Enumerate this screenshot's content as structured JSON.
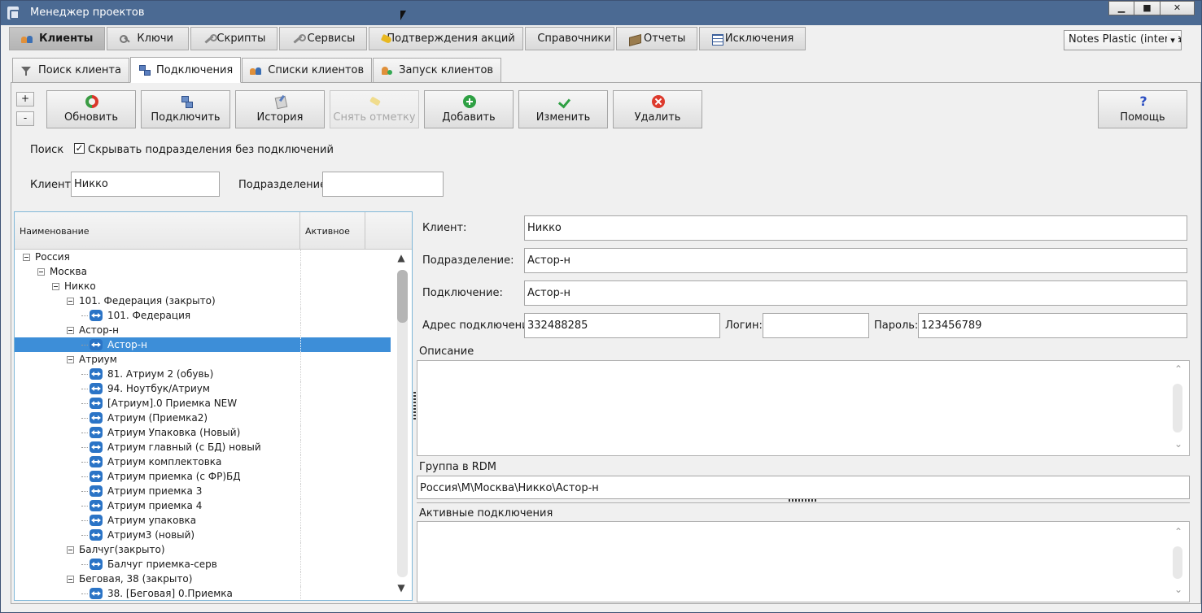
{
  "window": {
    "title": "Менеджер проектов",
    "buttons": {
      "minimize": "▁",
      "maximize": "■",
      "close": "✕"
    }
  },
  "main_tabs": [
    {
      "label": "Клиенты",
      "icon": "people-icon",
      "active": true
    },
    {
      "label": "Ключи",
      "icon": "key-icon"
    },
    {
      "label": "Скрипты",
      "icon": "wrench-icon"
    },
    {
      "label": "Сервисы",
      "icon": "wrench-icon"
    },
    {
      "label": "Подтверждения акций",
      "icon": "hand-icon"
    },
    {
      "label": "Справочники",
      "icon": ""
    },
    {
      "label": "Отчеты",
      "icon": "book-icon"
    },
    {
      "label": "Исключения",
      "icon": "table-icon"
    }
  ],
  "org_select": {
    "value": "Notes Plastic (interna"
  },
  "sub_tabs": [
    {
      "label": "Поиск клиента",
      "icon": "filter-icon"
    },
    {
      "label": "Подключения",
      "icon": "network-icon",
      "active": true
    },
    {
      "label": "Списки клиентов",
      "icon": "people-icon"
    },
    {
      "label": "Запуск клиентов",
      "icon": "launch-icon"
    }
  ],
  "expand_buttons": {
    "expand": "+",
    "collapse": "-"
  },
  "toolbar": {
    "refresh": "Обновить",
    "connect": "Подключить",
    "history": "История",
    "unmark": "Снять отметку",
    "add": "Добавить",
    "edit": "Изменить",
    "delete": "Удалить",
    "help": "Помощь",
    "help_glyph": "?"
  },
  "search": {
    "label": "Поиск",
    "hide_checkbox_label": "Скрывать подразделения без подключений",
    "hide_checked": true,
    "client_label": "Клиент:",
    "client_value": "Никко",
    "division_label": "Подразделение:",
    "division_value": ""
  },
  "tree": {
    "columns": {
      "name": "Наименование",
      "active": "Активное"
    },
    "rows": [
      {
        "level": 0,
        "type": "group",
        "label": "Россия"
      },
      {
        "level": 1,
        "type": "group",
        "label": "Москва"
      },
      {
        "level": 2,
        "type": "group",
        "label": "Никко"
      },
      {
        "level": 3,
        "type": "group",
        "label": "101. Федерация (закрыто)"
      },
      {
        "level": 4,
        "type": "conn",
        "label": "101. Федерация"
      },
      {
        "level": 3,
        "type": "group",
        "label": "Астор-н"
      },
      {
        "level": 4,
        "type": "conn",
        "label": "Астор-н",
        "selected": true
      },
      {
        "level": 3,
        "type": "group",
        "label": "Атриум"
      },
      {
        "level": 4,
        "type": "conn",
        "label": "81. Атриум 2 (обувь)"
      },
      {
        "level": 4,
        "type": "conn",
        "label": "94. Ноутбук/Атриум"
      },
      {
        "level": 4,
        "type": "conn",
        "label": "[Атриум].0 Приемка NEW"
      },
      {
        "level": 4,
        "type": "conn",
        "label": "Атриум (Приемка2)"
      },
      {
        "level": 4,
        "type": "conn",
        "label": "Атриум Упаковка (Новый)"
      },
      {
        "level": 4,
        "type": "conn",
        "label": "Атриум главный (с БД) новый"
      },
      {
        "level": 4,
        "type": "conn",
        "label": "Атриум комплектовка"
      },
      {
        "level": 4,
        "type": "conn",
        "label": "Атриум приемка (с ФР)БД"
      },
      {
        "level": 4,
        "type": "conn",
        "label": "Атриум приемка 3"
      },
      {
        "level": 4,
        "type": "conn",
        "label": "Атриум приемка 4"
      },
      {
        "level": 4,
        "type": "conn",
        "label": "Атриум упаковка"
      },
      {
        "level": 4,
        "type": "conn",
        "label": "Атриум3 (новый)"
      },
      {
        "level": 3,
        "type": "group",
        "label": "Балчуг(закрыто)"
      },
      {
        "level": 4,
        "type": "conn",
        "label": "Балчуг приемка-серв"
      },
      {
        "level": 3,
        "type": "group",
        "label": "Беговая, 38 (закрыто)"
      },
      {
        "level": 4,
        "type": "conn",
        "label": "38. [Беговая] 0.Приемка"
      }
    ],
    "scroll_up": "▲",
    "scroll_down": "▼"
  },
  "details": {
    "client_label": "Клиент:",
    "client_value": "Никко",
    "division_label": "Подразделение:",
    "division_value": "Астор-н",
    "connection_label": "Подключение:",
    "connection_value": "Астор-н",
    "address_label": "Адрес подключения",
    "address_value": "332488285",
    "login_label": "Логин:",
    "login_value": "",
    "password_label": "Пароль:",
    "password_value": "123456789",
    "description_label": "Описание",
    "description_value": "",
    "rdm_group_label": "Группа в RDM",
    "rdm_group_value": "Россия\\М\\Москва\\Никко\\Астор-н",
    "active_connections_label": "Активные подключения",
    "scroll_up": "⌃",
    "scroll_down": "⌄"
  }
}
